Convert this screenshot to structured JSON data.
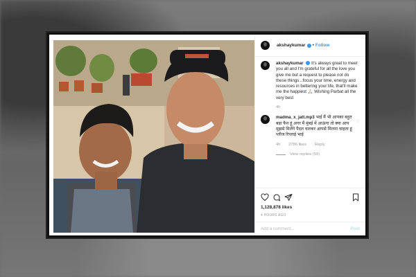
{
  "post": {
    "username": "akshaykumar",
    "follow_label": "Follow",
    "dot": "•",
    "caption": {
      "username": "akshaykumar",
      "text": "It's always great to meet you all and I'm grateful for all the love you give me but a request to please not do these things...focus your time, energy and resources in bettering your life, that'll make me the happiest 🙏🏻 Wishing Parbat all the very best",
      "time": "4h"
    },
    "comment": {
      "username": "madma_x_jatt.mp3",
      "text": "भाई मैं भी आपका बहुत बड़ा फैन हूं अगर मैं मुंबई में आऊंगा तो क्या आप मुझसे मिलेंगे पैदल चलकर आपसे मिलना चाहता हूं प्लीज रिप्लाई भाई",
      "time": "4h",
      "likes": "2786 likes",
      "reply_label": "Reply",
      "view_replies": "View replies (59)"
    },
    "likes": "1,128,878 likes",
    "posted_ago": "4 HOURS AGO",
    "add_comment_placeholder": "Add a comment...",
    "post_button": "Post",
    "colors": {
      "link_blue": "#3897f0",
      "text": "#262626",
      "muted": "#999999"
    },
    "icons": [
      "heart-icon",
      "comment-icon",
      "share-icon",
      "bookmark-icon"
    ]
  }
}
